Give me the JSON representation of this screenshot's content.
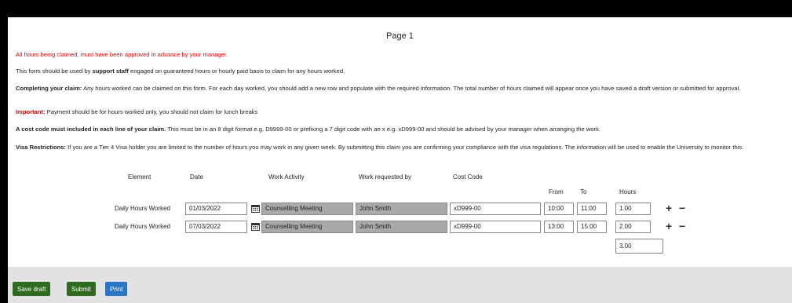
{
  "page": {
    "title": "Page 1"
  },
  "intro": {
    "approval_warning": "All hours being claimed, must have been approved in advance by your manager.",
    "usage": {
      "prefix": "This form should be used by ",
      "bold": "support staff",
      "suffix": " engaged on guaranteed hours or hourly paid basis to claim for any hours worked."
    },
    "completing": {
      "label": "Completing your claim:",
      "text": " Any hours worked can be claimed on this form. For each day worked, you should add a new row and populate with the required information. The total number of hours claimed will appear once you have saved a draft version or submitted for approval."
    },
    "important": {
      "label": "Important:",
      "text": " Payment should be for hours worked only, you should not claim for lunch breaks"
    },
    "cost_code": {
      "label": "A cost code must included in each line of your claim.",
      "text": " This must be in an 8 digit format e.g. D9999-00 or prefixing a 7 digit code with an x e.g. xD999-00 and should be advised by your manager when arranging the work."
    },
    "visa": {
      "label": "Visa Restrictions:",
      "text": " If you are a Tier 4 Visa holder you are limited to the number of hours you may work in any given week. By submitting this claim you are confirming your compliance with the visa regulations. The information will be used to enable the University to monitor this."
    }
  },
  "table": {
    "headers": {
      "element": "Element",
      "date": "Date",
      "activity": "Work Activity",
      "requested_by": "Work requested by",
      "cost_code": "Cost Code",
      "from": "From",
      "to": "To",
      "hours": "Hours"
    },
    "rows": [
      {
        "element": "Daily Hours Worked",
        "date": "01/03/2022",
        "activity": "Counselling Meeting",
        "requested_by": "John Smith",
        "cost_code": "xD999-00",
        "from": "10:00",
        "to": "11:00",
        "hours": "1.00"
      },
      {
        "element": "Daily Hours Worked",
        "date": "07/03/2022",
        "activity": "Counselling Meeting",
        "requested_by": "John Smith",
        "cost_code": "xD999-00",
        "from": "13:00",
        "to": "15:00",
        "hours": "2.00"
      }
    ],
    "total": "3.00",
    "add_symbol": "+",
    "remove_symbol": "−"
  },
  "buttons": {
    "save_draft": "Save draft",
    "submit": "Submit",
    "print": "Print"
  },
  "icons": {
    "date_picker": "calendar-icon"
  },
  "colors": {
    "warning_red": "#e00000",
    "readonly_grey": "#a9a9a9",
    "save_green": "#2e6b1f",
    "print_blue": "#2a76c6",
    "footer_grey": "#e2e2e2"
  }
}
